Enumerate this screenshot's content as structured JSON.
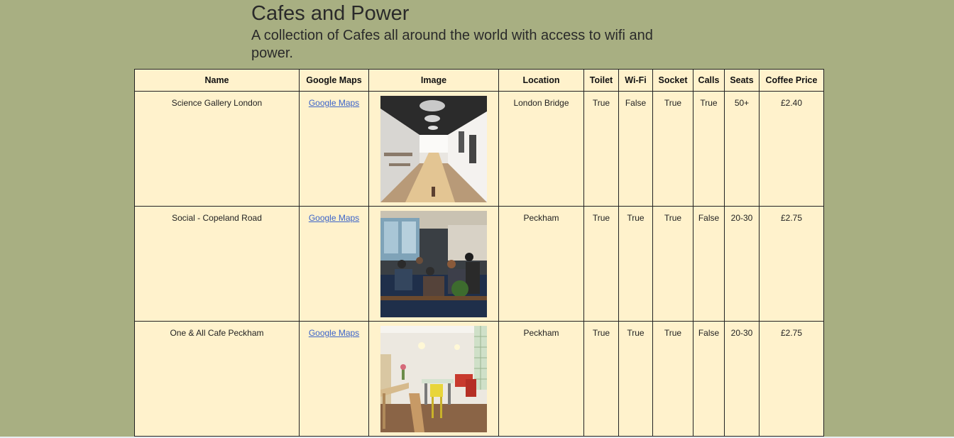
{
  "header": {
    "title": "Cafes and Power",
    "subtitle": "A collection of Cafes all around the world with access to wifi and power."
  },
  "table": {
    "columns": [
      "Name",
      "Google Maps",
      "Image",
      "Location",
      "Toilet",
      "Wi-Fi",
      "Socket",
      "Calls",
      "Seats",
      "Coffee Price"
    ],
    "rows": [
      {
        "name": "Science Gallery London",
        "maps_label": "Google Maps",
        "image": "cafe-long-hall-photo",
        "location": "London Bridge",
        "toilet": "True",
        "wifi": "False",
        "socket": "True",
        "calls": "True",
        "seats": "50+",
        "price": "£2.40"
      },
      {
        "name": "Social - Copeland Road",
        "maps_label": "Google Maps",
        "image": "cafe-busy-interior-photo",
        "location": "Peckham",
        "toilet": "True",
        "wifi": "True",
        "socket": "True",
        "calls": "False",
        "seats": "20-30",
        "price": "£2.75"
      },
      {
        "name": "One & All Cafe Peckham",
        "maps_label": "Google Maps",
        "image": "cafe-bright-room-photo",
        "location": "Peckham",
        "toilet": "True",
        "wifi": "True",
        "socket": "True",
        "calls": "False",
        "seats": "20-30",
        "price": "£2.75"
      }
    ]
  },
  "colors": {
    "background": "#a8af82",
    "table_background": "#fff2cc",
    "link": "#3b64c9"
  }
}
